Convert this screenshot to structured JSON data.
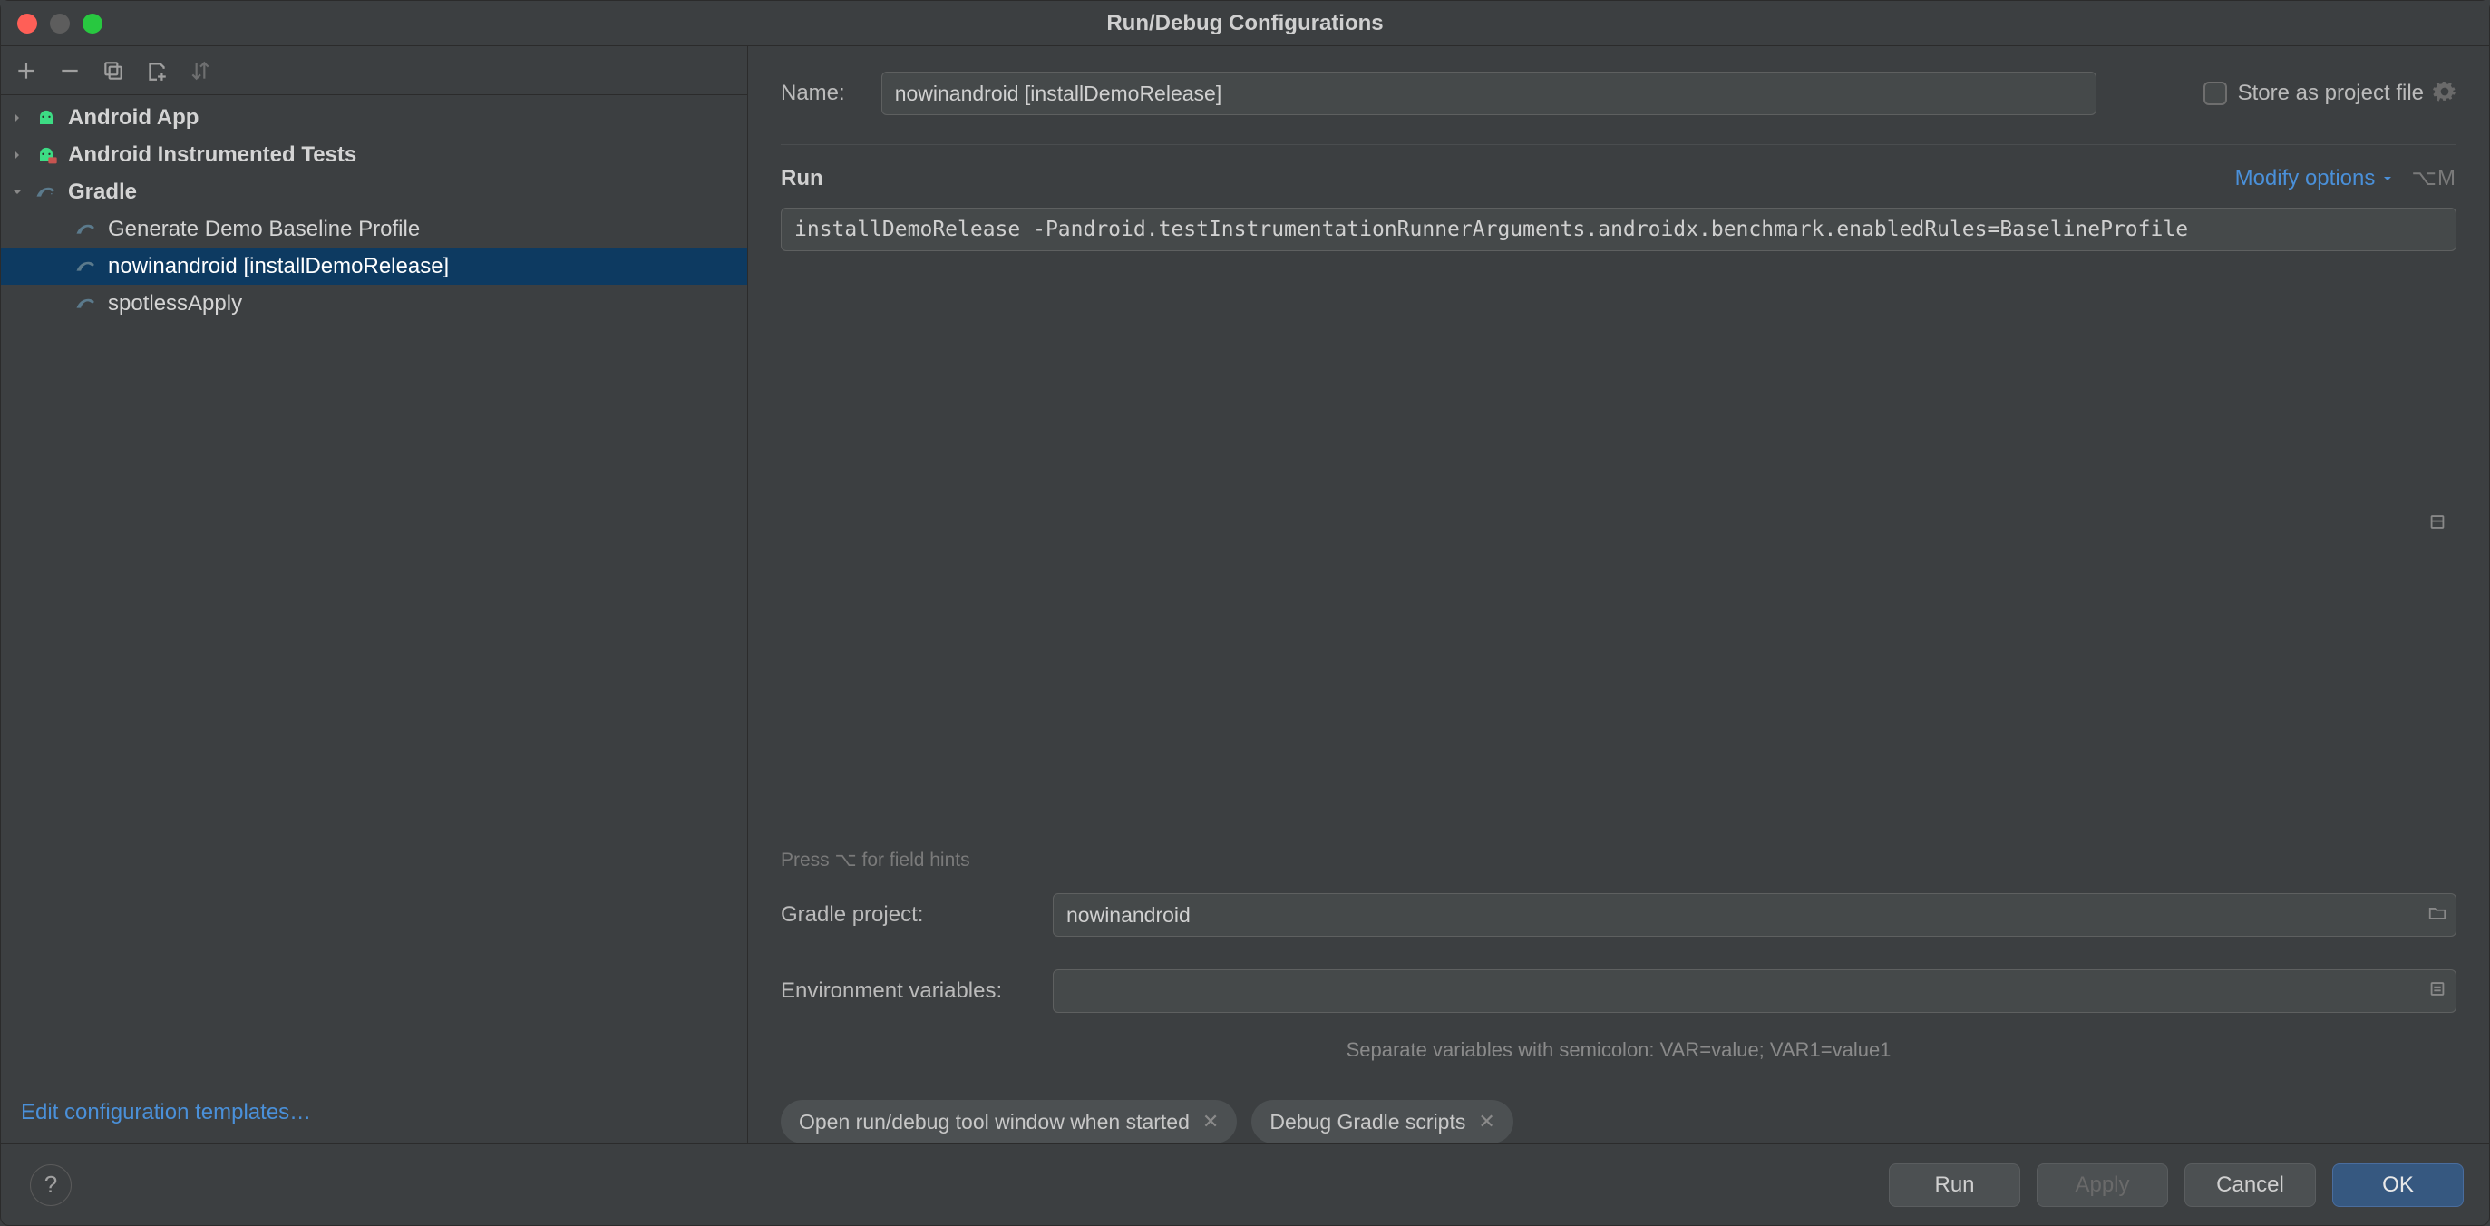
{
  "window": {
    "title": "Run/Debug Configurations"
  },
  "toolbar": {},
  "tree": {
    "nodes": [
      {
        "label": "Android App",
        "expanded": false,
        "bold": true,
        "icon": "android"
      },
      {
        "label": "Android Instrumented Tests",
        "expanded": false,
        "bold": true,
        "icon": "android-test"
      },
      {
        "label": "Gradle",
        "expanded": true,
        "bold": true,
        "icon": "gradle",
        "children": [
          {
            "label": "Generate Demo Baseline Profile",
            "selected": false
          },
          {
            "label": "nowinandroid [installDemoRelease]",
            "selected": true
          },
          {
            "label": "spotlessApply",
            "selected": false
          }
        ]
      }
    ],
    "edit_templates": "Edit configuration templates…"
  },
  "form": {
    "name_label": "Name:",
    "name_value": "nowinandroid [installDemoRelease]",
    "store_label": "Store as project file",
    "run_section": "Run",
    "modify_options": "Modify options",
    "modify_shortcut": "⌥M",
    "run_command": "installDemoRelease -Pandroid.testInstrumentationRunnerArguments.androidx.benchmark.enabledRules=BaselineProfile",
    "run_hint": "Press ⌥ for field hints",
    "gradle_project_label": "Gradle project:",
    "gradle_project_value": "nowinandroid",
    "env_label": "Environment variables:",
    "env_value": "",
    "env_hint": "Separate variables with semicolon: VAR=value; VAR1=value1",
    "tags": [
      "Open run/debug tool window when started",
      "Debug Gradle scripts"
    ]
  },
  "footer": {
    "run": "Run",
    "apply": "Apply",
    "cancel": "Cancel",
    "ok": "OK"
  }
}
